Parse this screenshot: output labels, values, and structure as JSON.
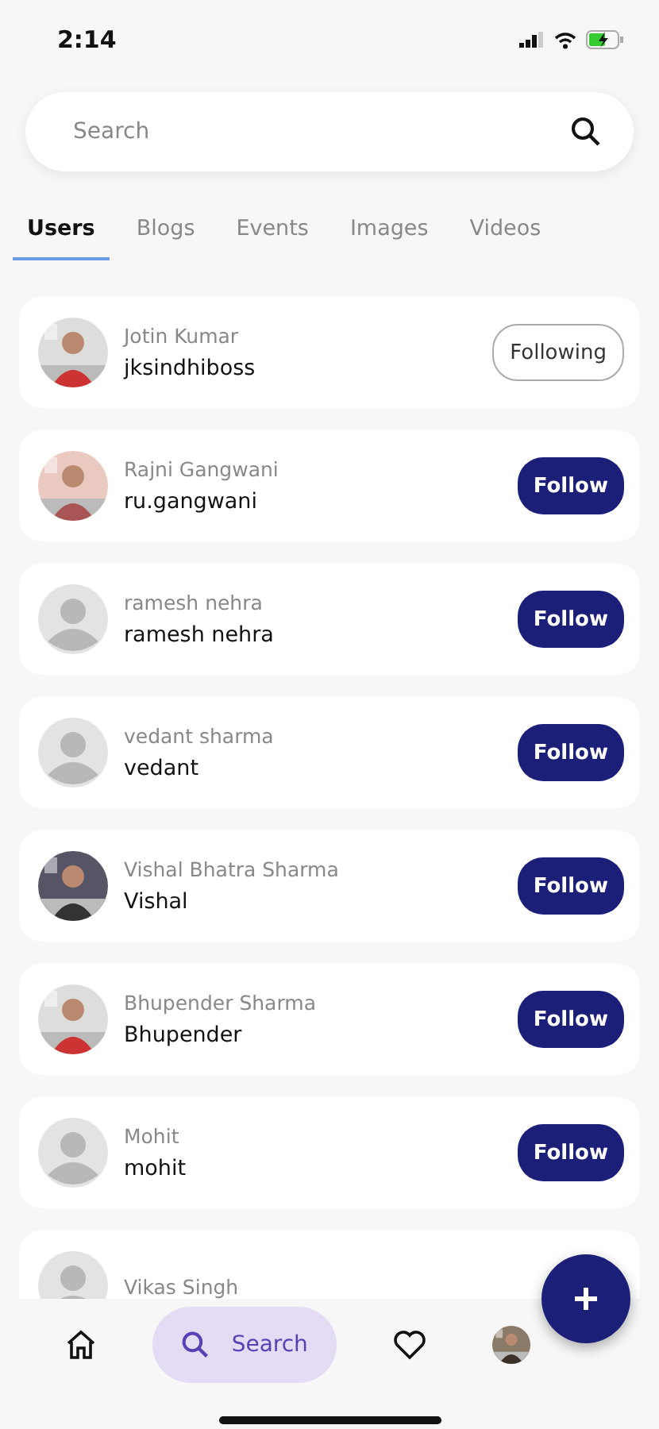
{
  "status_bar": {
    "time": "2:14"
  },
  "search": {
    "placeholder": "Search"
  },
  "tabs": [
    {
      "label": "Users",
      "selected": true
    },
    {
      "label": "Blogs",
      "selected": false
    },
    {
      "label": "Events",
      "selected": false
    },
    {
      "label": "Images",
      "selected": false
    },
    {
      "label": "Videos",
      "selected": false
    }
  ],
  "users": [
    {
      "name": "Jotin Kumar",
      "username": "jksindhiboss",
      "button": "Following",
      "following": true
    },
    {
      "name": "Rajni Gangwani",
      "username": "ru.gangwani",
      "button": "Follow",
      "following": false
    },
    {
      "name": "ramesh nehra",
      "username": "ramesh nehra",
      "kind": "default",
      "button": "Follow",
      "following": false
    },
    {
      "name": "vedant sharma",
      "username": "vedant",
      "kind": "default",
      "button": "Follow",
      "following": false
    },
    {
      "name": "Vishal Bhatra Sharma",
      "username": "Vishal",
      "button": "Follow",
      "following": false
    },
    {
      "name": "Bhupender Sharma",
      "username": "Bhupender",
      "button": "Follow",
      "following": false
    },
    {
      "name": "Mohit",
      "username": "mohit",
      "kind": "default",
      "button": "Follow",
      "following": false
    },
    {
      "name": "Vikas Singh",
      "kind": "default"
    }
  ],
  "bottom_nav": [
    {
      "kind": "home",
      "selected": false
    },
    {
      "kind": "search",
      "label": "Search",
      "selected": true
    },
    {
      "kind": "favorites",
      "selected": false
    },
    {
      "kind": "profile",
      "selected": false
    }
  ]
}
